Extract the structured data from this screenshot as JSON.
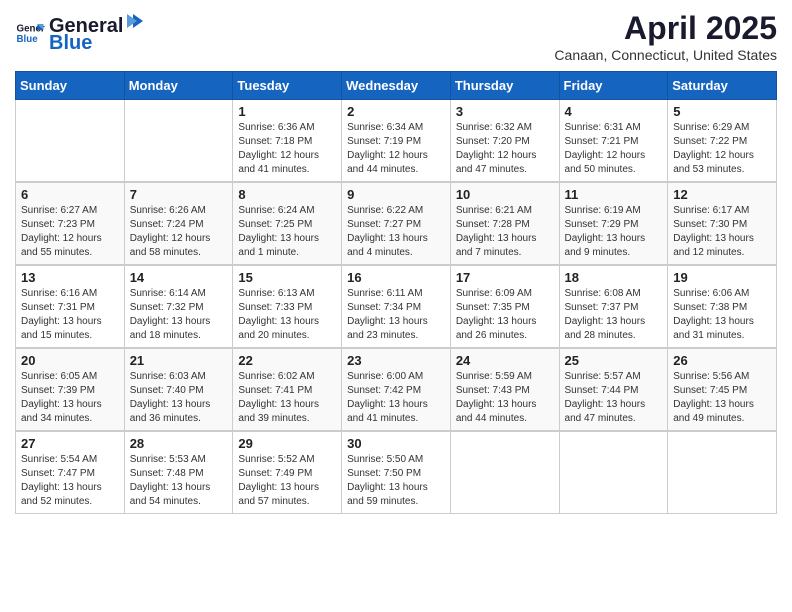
{
  "logo": {
    "text_general": "General",
    "text_blue": "Blue"
  },
  "title": "April 2025",
  "location": "Canaan, Connecticut, United States",
  "headers": [
    "Sunday",
    "Monday",
    "Tuesday",
    "Wednesday",
    "Thursday",
    "Friday",
    "Saturday"
  ],
  "weeks": [
    [
      {
        "day": "",
        "sunrise": "",
        "sunset": "",
        "daylight": ""
      },
      {
        "day": "",
        "sunrise": "",
        "sunset": "",
        "daylight": ""
      },
      {
        "day": "1",
        "sunrise": "Sunrise: 6:36 AM",
        "sunset": "Sunset: 7:18 PM",
        "daylight": "Daylight: 12 hours and 41 minutes."
      },
      {
        "day": "2",
        "sunrise": "Sunrise: 6:34 AM",
        "sunset": "Sunset: 7:19 PM",
        "daylight": "Daylight: 12 hours and 44 minutes."
      },
      {
        "day": "3",
        "sunrise": "Sunrise: 6:32 AM",
        "sunset": "Sunset: 7:20 PM",
        "daylight": "Daylight: 12 hours and 47 minutes."
      },
      {
        "day": "4",
        "sunrise": "Sunrise: 6:31 AM",
        "sunset": "Sunset: 7:21 PM",
        "daylight": "Daylight: 12 hours and 50 minutes."
      },
      {
        "day": "5",
        "sunrise": "Sunrise: 6:29 AM",
        "sunset": "Sunset: 7:22 PM",
        "daylight": "Daylight: 12 hours and 53 minutes."
      }
    ],
    [
      {
        "day": "6",
        "sunrise": "Sunrise: 6:27 AM",
        "sunset": "Sunset: 7:23 PM",
        "daylight": "Daylight: 12 hours and 55 minutes."
      },
      {
        "day": "7",
        "sunrise": "Sunrise: 6:26 AM",
        "sunset": "Sunset: 7:24 PM",
        "daylight": "Daylight: 12 hours and 58 minutes."
      },
      {
        "day": "8",
        "sunrise": "Sunrise: 6:24 AM",
        "sunset": "Sunset: 7:25 PM",
        "daylight": "Daylight: 13 hours and 1 minute."
      },
      {
        "day": "9",
        "sunrise": "Sunrise: 6:22 AM",
        "sunset": "Sunset: 7:27 PM",
        "daylight": "Daylight: 13 hours and 4 minutes."
      },
      {
        "day": "10",
        "sunrise": "Sunrise: 6:21 AM",
        "sunset": "Sunset: 7:28 PM",
        "daylight": "Daylight: 13 hours and 7 minutes."
      },
      {
        "day": "11",
        "sunrise": "Sunrise: 6:19 AM",
        "sunset": "Sunset: 7:29 PM",
        "daylight": "Daylight: 13 hours and 9 minutes."
      },
      {
        "day": "12",
        "sunrise": "Sunrise: 6:17 AM",
        "sunset": "Sunset: 7:30 PM",
        "daylight": "Daylight: 13 hours and 12 minutes."
      }
    ],
    [
      {
        "day": "13",
        "sunrise": "Sunrise: 6:16 AM",
        "sunset": "Sunset: 7:31 PM",
        "daylight": "Daylight: 13 hours and 15 minutes."
      },
      {
        "day": "14",
        "sunrise": "Sunrise: 6:14 AM",
        "sunset": "Sunset: 7:32 PM",
        "daylight": "Daylight: 13 hours and 18 minutes."
      },
      {
        "day": "15",
        "sunrise": "Sunrise: 6:13 AM",
        "sunset": "Sunset: 7:33 PM",
        "daylight": "Daylight: 13 hours and 20 minutes."
      },
      {
        "day": "16",
        "sunrise": "Sunrise: 6:11 AM",
        "sunset": "Sunset: 7:34 PM",
        "daylight": "Daylight: 13 hours and 23 minutes."
      },
      {
        "day": "17",
        "sunrise": "Sunrise: 6:09 AM",
        "sunset": "Sunset: 7:35 PM",
        "daylight": "Daylight: 13 hours and 26 minutes."
      },
      {
        "day": "18",
        "sunrise": "Sunrise: 6:08 AM",
        "sunset": "Sunset: 7:37 PM",
        "daylight": "Daylight: 13 hours and 28 minutes."
      },
      {
        "day": "19",
        "sunrise": "Sunrise: 6:06 AM",
        "sunset": "Sunset: 7:38 PM",
        "daylight": "Daylight: 13 hours and 31 minutes."
      }
    ],
    [
      {
        "day": "20",
        "sunrise": "Sunrise: 6:05 AM",
        "sunset": "Sunset: 7:39 PM",
        "daylight": "Daylight: 13 hours and 34 minutes."
      },
      {
        "day": "21",
        "sunrise": "Sunrise: 6:03 AM",
        "sunset": "Sunset: 7:40 PM",
        "daylight": "Daylight: 13 hours and 36 minutes."
      },
      {
        "day": "22",
        "sunrise": "Sunrise: 6:02 AM",
        "sunset": "Sunset: 7:41 PM",
        "daylight": "Daylight: 13 hours and 39 minutes."
      },
      {
        "day": "23",
        "sunrise": "Sunrise: 6:00 AM",
        "sunset": "Sunset: 7:42 PM",
        "daylight": "Daylight: 13 hours and 41 minutes."
      },
      {
        "day": "24",
        "sunrise": "Sunrise: 5:59 AM",
        "sunset": "Sunset: 7:43 PM",
        "daylight": "Daylight: 13 hours and 44 minutes."
      },
      {
        "day": "25",
        "sunrise": "Sunrise: 5:57 AM",
        "sunset": "Sunset: 7:44 PM",
        "daylight": "Daylight: 13 hours and 47 minutes."
      },
      {
        "day": "26",
        "sunrise": "Sunrise: 5:56 AM",
        "sunset": "Sunset: 7:45 PM",
        "daylight": "Daylight: 13 hours and 49 minutes."
      }
    ],
    [
      {
        "day": "27",
        "sunrise": "Sunrise: 5:54 AM",
        "sunset": "Sunset: 7:47 PM",
        "daylight": "Daylight: 13 hours and 52 minutes."
      },
      {
        "day": "28",
        "sunrise": "Sunrise: 5:53 AM",
        "sunset": "Sunset: 7:48 PM",
        "daylight": "Daylight: 13 hours and 54 minutes."
      },
      {
        "day": "29",
        "sunrise": "Sunrise: 5:52 AM",
        "sunset": "Sunset: 7:49 PM",
        "daylight": "Daylight: 13 hours and 57 minutes."
      },
      {
        "day": "30",
        "sunrise": "Sunrise: 5:50 AM",
        "sunset": "Sunset: 7:50 PM",
        "daylight": "Daylight: 13 hours and 59 minutes."
      },
      {
        "day": "",
        "sunrise": "",
        "sunset": "",
        "daylight": ""
      },
      {
        "day": "",
        "sunrise": "",
        "sunset": "",
        "daylight": ""
      },
      {
        "day": "",
        "sunrise": "",
        "sunset": "",
        "daylight": ""
      }
    ]
  ]
}
